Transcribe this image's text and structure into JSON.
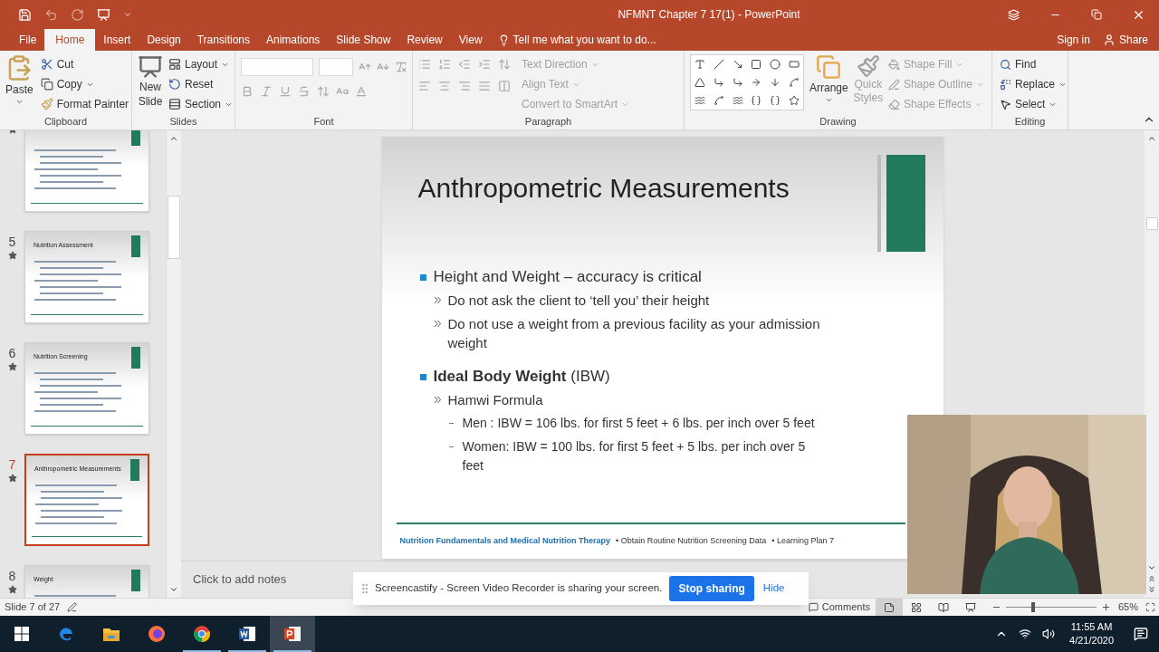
{
  "window": {
    "title": "NFMNT Chapter 7 17(1) - PowerPoint"
  },
  "ribbon_tabs": [
    {
      "label": "File",
      "selected": false
    },
    {
      "label": "Home",
      "selected": true
    },
    {
      "label": "Insert",
      "selected": false
    },
    {
      "label": "Design",
      "selected": false
    },
    {
      "label": "Transitions",
      "selected": false
    },
    {
      "label": "Animations",
      "selected": false
    },
    {
      "label": "Slide Show",
      "selected": false
    },
    {
      "label": "Review",
      "selected": false
    },
    {
      "label": "View",
      "selected": false
    }
  ],
  "tell_me": "Tell me what you want to do...",
  "account": {
    "sign_in": "Sign in",
    "share": "Share"
  },
  "clipboard": {
    "label": "Clipboard",
    "paste": "Paste",
    "cut": "Cut",
    "copy": "Copy",
    "format_painter": "Format Painter"
  },
  "slides_group": {
    "label": "Slides",
    "new_slide": "New Slide",
    "layout": "Layout",
    "reset": "Reset",
    "section": "Section"
  },
  "font_group": {
    "label": "Font"
  },
  "paragraph": {
    "label": "Paragraph",
    "text_direction": "Text Direction",
    "align_text": "Align Text",
    "convert": "Convert to SmartArt"
  },
  "drawing": {
    "label": "Drawing",
    "arrange": "Arrange",
    "quick_styles": "Quick Styles",
    "shape_fill": "Shape Fill",
    "shape_outline": "Shape Outline",
    "shape_effects": "Shape Effects"
  },
  "editing": {
    "label": "Editing",
    "find": "Find",
    "replace": "Replace",
    "select": "Select"
  },
  "thumbnails": [
    {
      "selected": false
    },
    {
      "number": "5",
      "title": "Nutrition Assessment",
      "selected": false
    },
    {
      "number": "6",
      "title": "Nutrition Screening",
      "selected": false
    },
    {
      "number": "7",
      "title": "Anthropometric Measurements",
      "selected": true
    },
    {
      "number": "8",
      "title": "Weight",
      "selected": false
    }
  ],
  "slide": {
    "title": "Anthropometric Measurements",
    "bullets": [
      {
        "text": "Height and Weight – accuracy is critical",
        "children": [
          {
            "text": "Do not ask the client to ‘tell you’ their height"
          },
          {
            "text": "Do not use a weight from a previous facility as your admission weight"
          }
        ]
      },
      {
        "text": "**Ideal Body Weight**  (IBW)",
        "children": [
          {
            "text": "Hamwi Formula",
            "children": [
              {
                "text": "Men :  IBW = 106 lbs. for first 5 feet  +  6 lbs. per inch over 5 feet"
              },
              {
                "text": "Women:  IBW = 100 lbs. for first 5 feet + 5 lbs. per inch over 5 feet"
              }
            ]
          }
        ]
      }
    ],
    "footer": {
      "course": "Nutrition Fundamentals and Medical Nutrition Therapy",
      "parts": [
        "• Obtain Routine Nutrition Screening Data",
        "• Learning Plan 7"
      ]
    }
  },
  "notes_placeholder": "Click to add notes",
  "status_bar": {
    "slide": "Slide 7 of 27",
    "comments": "Comments",
    "views": [
      {
        "kind": "normal",
        "selected": true
      },
      {
        "kind": "sorter",
        "selected": false
      },
      {
        "kind": "reading",
        "selected": false
      },
      {
        "kind": "slideshow",
        "selected": false
      }
    ],
    "zoom": {
      "level": 0.3,
      "reading": "65%"
    }
  },
  "sharing_bar": {
    "message": "Screencastify - Screen Video Recorder is sharing your screen.",
    "stop": "Stop sharing",
    "hide": "Hide"
  },
  "taskbar": {
    "apps": [
      {
        "kind": "edge",
        "running": false,
        "selected": false
      },
      {
        "kind": "explorer",
        "running": false,
        "selected": false
      },
      {
        "kind": "firefox",
        "running": false,
        "selected": false
      },
      {
        "kind": "chrome",
        "running": true,
        "selected": false
      },
      {
        "kind": "word",
        "running": true,
        "selected": false
      },
      {
        "kind": "powerpoint",
        "running": true,
        "selected": true
      }
    ],
    "time": "11:55 AM",
    "date": "4/21/2020"
  }
}
